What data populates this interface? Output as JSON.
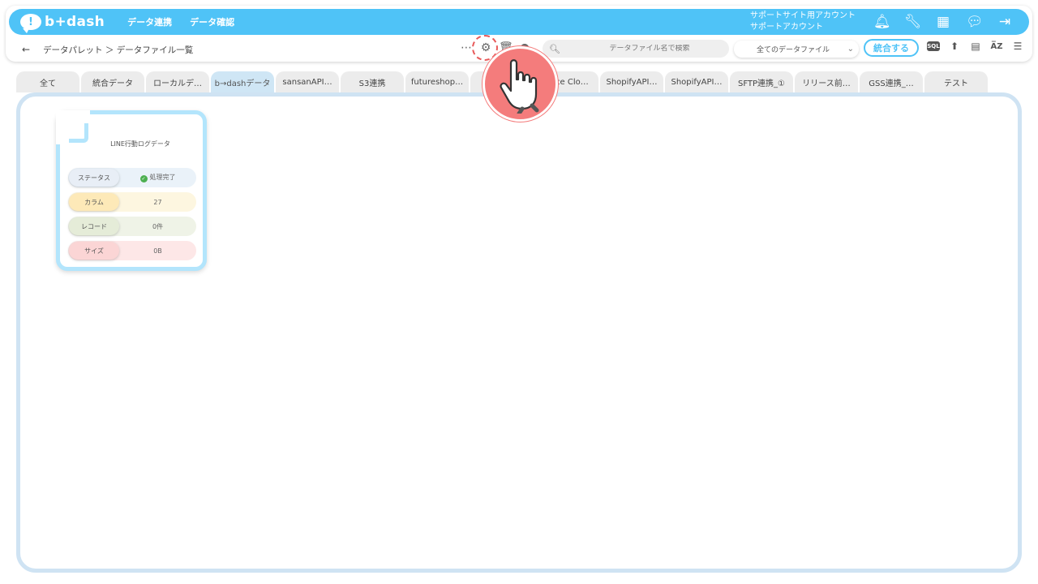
{
  "app": {
    "logo_text": "b+dash",
    "nav": [
      "データ連携",
      "データ確認"
    ],
    "account_line1": "サポートサイト用アカウント",
    "account_line2": "サポートアカウント",
    "top_icons": [
      "bell-icon",
      "wrench-icon",
      "apps-grid-icon",
      "chat-icon",
      "logout-icon"
    ]
  },
  "toolbar": {
    "back_label": "←",
    "breadcrumb": "データパレット ＞ データファイル一覧",
    "search_placeholder": "データファイル名で検索",
    "filter_value": "全てのデータファイル",
    "merge_label": "統合する",
    "sql_label": "SQL"
  },
  "tabs": [
    {
      "label": "全て",
      "active": false
    },
    {
      "label": "統合データ",
      "active": false
    },
    {
      "label": "ローカルデ…",
      "active": false
    },
    {
      "label": "b→dashデータ",
      "active": true
    },
    {
      "label": "sansanAPI…",
      "active": false
    },
    {
      "label": "S3連携",
      "active": false
    },
    {
      "label": "futureshop…",
      "active": false
    },
    {
      "label": "",
      "active": false
    },
    {
      "label": "rvice Clo…",
      "active": false
    },
    {
      "label": "ShopifyAPI…",
      "active": false
    },
    {
      "label": "ShopifyAPI…",
      "active": false
    },
    {
      "label": "SFTP連携_①",
      "active": false
    },
    {
      "label": "リリース前…",
      "active": false
    },
    {
      "label": "GSS連携_…",
      "active": false
    },
    {
      "label": "テスト",
      "active": false
    }
  ],
  "file_card": {
    "title": "LINE行動ログデータ",
    "status_label": "ステータス",
    "status_value": "処理完了",
    "column_label": "カラム",
    "column_value": "27",
    "record_label": "レコード",
    "record_value": "0件",
    "size_label": "サイズ",
    "size_value": "0B"
  }
}
